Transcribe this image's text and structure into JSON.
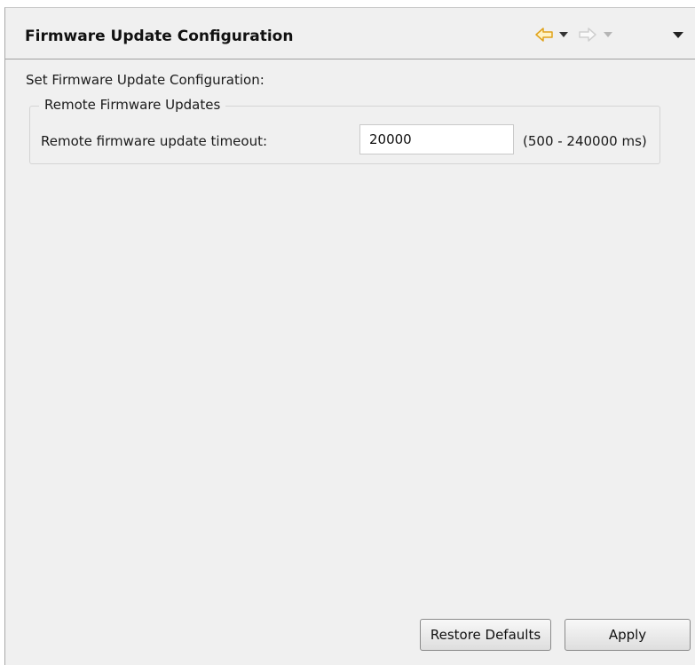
{
  "header": {
    "title": "Firmware Update Configuration",
    "icons": {
      "back": "arrow-left-icon",
      "back_menu": "chevron-down-icon",
      "forward": "arrow-right-icon",
      "forward_menu": "chevron-down-icon",
      "view_menu": "view-menu-icon"
    },
    "colors": {
      "back_arrow": "#f2b72c",
      "forward_arrow": "#d9d9d9"
    }
  },
  "content": {
    "description": "Set Firmware Update Configuration:",
    "group": {
      "title": "Remote Firmware Updates",
      "field_label": "Remote firmware update timeout:",
      "field_value": "20000",
      "range_hint": "(500 - 240000 ms)"
    }
  },
  "buttons": {
    "restore_defaults": "Restore Defaults",
    "apply": "Apply"
  }
}
